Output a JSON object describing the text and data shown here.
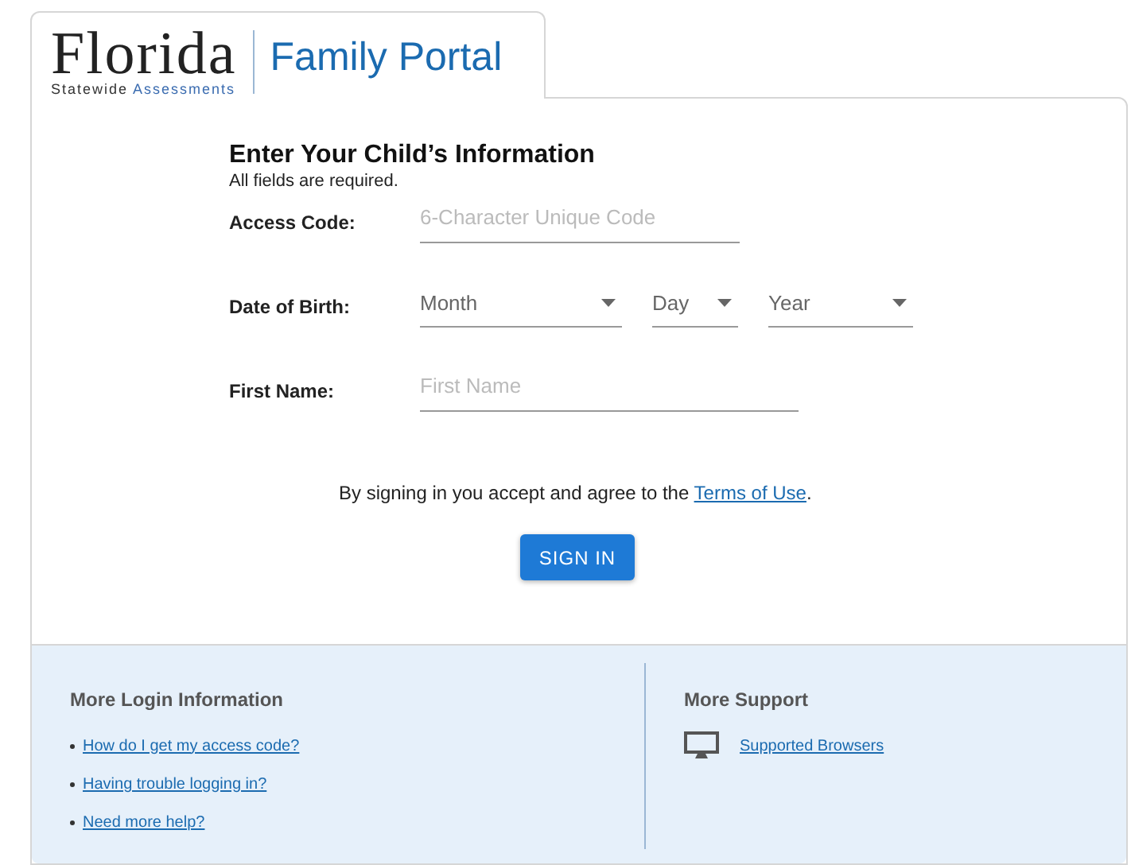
{
  "header": {
    "logo_word": "Florida",
    "logo_sub_1": "Statewide",
    "logo_sub_2": "Assessments",
    "portal_title": "Family Portal"
  },
  "form": {
    "title": "Enter Your Child’s Information",
    "note": "All fields are required.",
    "rows": [
      {
        "kind": "text",
        "label": "Access Code:",
        "fields": [
          {
            "placeholder": "6-Character Unique Code"
          }
        ]
      },
      {
        "kind": "select",
        "label": "Date of Birth:",
        "fields": [
          {
            "placeholder": "Month"
          },
          {
            "placeholder": "Day"
          },
          {
            "placeholder": "Year"
          }
        ]
      },
      {
        "kind": "text",
        "label": "First Name:",
        "fields": [
          {
            "placeholder": "First Name"
          }
        ]
      }
    ],
    "agreement": {
      "before": "By signing in you accept and agree to the",
      "link": "Terms of Use",
      "after": "."
    },
    "submit": "SIGN IN"
  },
  "footer": {
    "login_info": {
      "title": "More Login Information",
      "links": [
        "How do I get my access code?",
        "Having trouble logging in?",
        "Need more help?"
      ]
    },
    "support": {
      "title": "More Support",
      "links": [
        "Supported Browsers"
      ]
    }
  }
}
